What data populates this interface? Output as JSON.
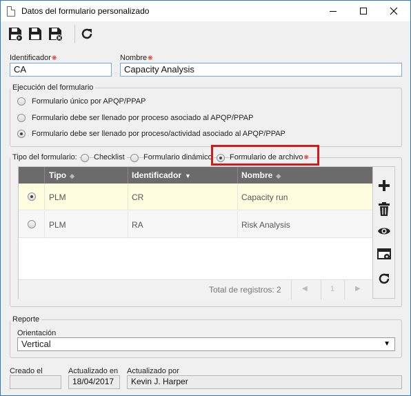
{
  "window": {
    "title": "Datos del formulario personalizado"
  },
  "toolbar": {
    "buttons": [
      "save-new-icon",
      "save-icon",
      "save-close-icon",
      "refresh-icon"
    ]
  },
  "fields": {
    "identificador_label": "Identificador",
    "identificador_value": "CA",
    "nombre_label": "Nombre",
    "nombre_value": "Capacity Analysis",
    "required_mark": "❋"
  },
  "ejecucion": {
    "title": "Ejecución del formulario",
    "options": [
      {
        "label": "Formulario único por APQP/PPAP",
        "selected": false
      },
      {
        "label": "Formulario debe ser llenado por proceso asociado al APQP/PPAP",
        "selected": false
      },
      {
        "label": "Formulario debe ser llenado por proceso/actividad asociado al APQP/PPAP",
        "selected": true
      }
    ]
  },
  "tipo": {
    "title": "Tipo del formulario:",
    "options": [
      {
        "label": "Checklist",
        "selected": false
      },
      {
        "label": "Formulario dinámico",
        "selected": false
      },
      {
        "label": "Formulario de archivo",
        "selected": true
      }
    ]
  },
  "grid": {
    "columns": [
      "Tipo",
      "Identificador",
      "Nombre"
    ],
    "rows": [
      {
        "tipo": "PLM",
        "identificador": "CR",
        "nombre": "Capacity run",
        "selected": true
      },
      {
        "tipo": "PLM",
        "identificador": "RA",
        "nombre": "Risk Analysis",
        "selected": false
      }
    ],
    "total_label": "Total de registros: 2",
    "page": "1"
  },
  "reporte": {
    "title": "Reporte",
    "orientacion_label": "Orientación",
    "orientacion_value": "Vertical"
  },
  "footer": {
    "creado_label": "Creado el",
    "creado_value": "",
    "actualizado_en_label": "Actualizado en",
    "actualizado_en_value": "18/04/2017",
    "actualizado_por_label": "Actualizado por",
    "actualizado_por_value": "Kevin J. Harper"
  },
  "colors": {
    "accent": "#d11a1a",
    "selected_row": "#fffde0",
    "header": "#6b6b6b",
    "border": "#2b79c2"
  }
}
